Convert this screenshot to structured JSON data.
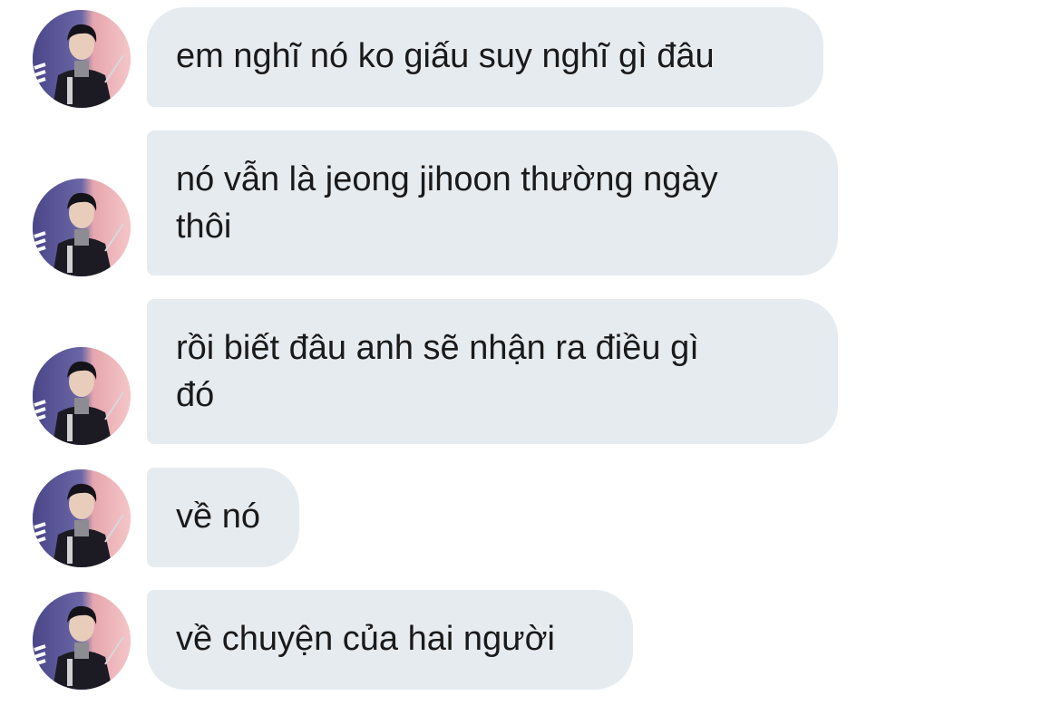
{
  "messages": [
    {
      "text": "em nghĩ nó ko giấu suy nghĩ gì đâu",
      "avatar_icon": "profile-photo"
    },
    {
      "line1": "nó vẫn là jeong jihoon thường ngày",
      "line2": "thôi",
      "avatar_icon": "profile-photo"
    },
    {
      "line1": "rồi biết đâu anh sẽ nhận ra điều gì",
      "line2": "đó",
      "avatar_icon": "profile-photo"
    },
    {
      "text": "về nó",
      "avatar_icon": "profile-photo"
    },
    {
      "text": "về chuyện của hai người",
      "avatar_icon": "profile-photo"
    }
  ],
  "colors": {
    "bubble_bg": "#e6ebf0",
    "text": "#1a1a1a",
    "background": "#ffffff"
  }
}
